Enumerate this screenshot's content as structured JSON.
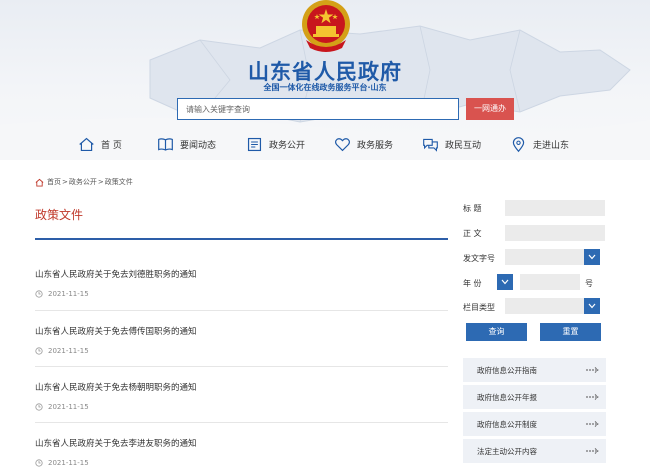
{
  "header": {
    "title": "山东省人民政府",
    "subtitle": "全国一体化在线政务服务平台·山东",
    "search_placeholder": "请输入关键字查询",
    "search_button": "一网通办",
    "brand_color": "#1f5aa8"
  },
  "nav": {
    "items": [
      {
        "label": "首 页",
        "icon": "home-icon"
      },
      {
        "label": "要闻动态",
        "icon": "book-icon"
      },
      {
        "label": "政务公开",
        "icon": "document-icon"
      },
      {
        "label": "政务服务",
        "icon": "heart-icon"
      },
      {
        "label": "政民互动",
        "icon": "chat-icon"
      },
      {
        "label": "走进山东",
        "icon": "location-icon"
      }
    ]
  },
  "breadcrumb": {
    "items": [
      "首页",
      "政务公开",
      "政策文件"
    ],
    "separator": ">"
  },
  "main": {
    "section_title": "政策文件",
    "accent_color": "#c0392b",
    "documents": [
      {
        "title": "山东省人民政府关于免去刘德胜职务的通知",
        "date": "2021-11-15"
      },
      {
        "title": "山东省人民政府关于免去傅传国职务的通知",
        "date": "2021-11-15"
      },
      {
        "title": "山东省人民政府关于免去杨朝明职务的通知",
        "date": "2021-11-15"
      },
      {
        "title": "山东省人民政府关于免去李进友职务的通知",
        "date": "2021-11-15"
      }
    ]
  },
  "filter": {
    "title_label": "标 题",
    "content_label": "正 文",
    "doc_number_label": "发文字号",
    "year_label": "年 份",
    "number_suffix": "号",
    "category_label": "栏目类型",
    "query_button": "查询",
    "reset_button": "重置"
  },
  "links": {
    "items": [
      {
        "label": "政府信息公开指南"
      },
      {
        "label": "政府信息公开年报"
      },
      {
        "label": "政府信息公开制度"
      },
      {
        "label": "法定主动公开内容"
      }
    ]
  }
}
